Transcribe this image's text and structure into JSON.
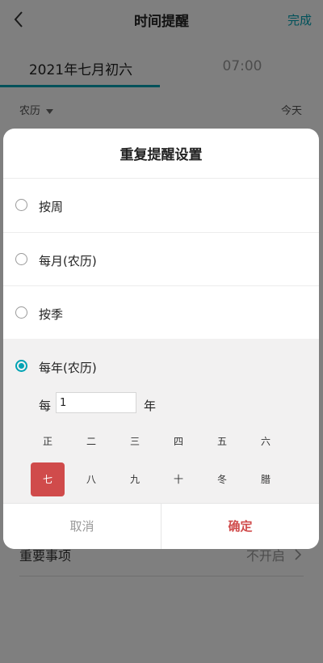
{
  "header": {
    "title": "时间提醒",
    "done_label": "完成"
  },
  "tabs": [
    {
      "label": "2021年七月初六"
    },
    {
      "label": "07:00"
    }
  ],
  "subrow": {
    "calendar_type": "农历",
    "today": "今天"
  },
  "important": {
    "label": "重要事项",
    "value": "不开启"
  },
  "dialog": {
    "title": "重复提醒设置",
    "options": [
      {
        "label": "按周",
        "checked": false
      },
      {
        "label": "每月(农历)",
        "checked": false
      },
      {
        "label": "按季",
        "checked": false
      },
      {
        "label": "每年(农历)",
        "checked": true
      }
    ],
    "every_label": "每",
    "interval_value": "1",
    "year_unit": "年",
    "months": [
      "正",
      "二",
      "三",
      "四",
      "五",
      "六",
      "七",
      "八",
      "九",
      "十",
      "冬",
      "腊"
    ],
    "selected_month": "七",
    "cancel_label": "取消",
    "ok_label": "确定"
  },
  "colors": {
    "accent": "#00a3b4",
    "selected": "#d04b4b"
  }
}
